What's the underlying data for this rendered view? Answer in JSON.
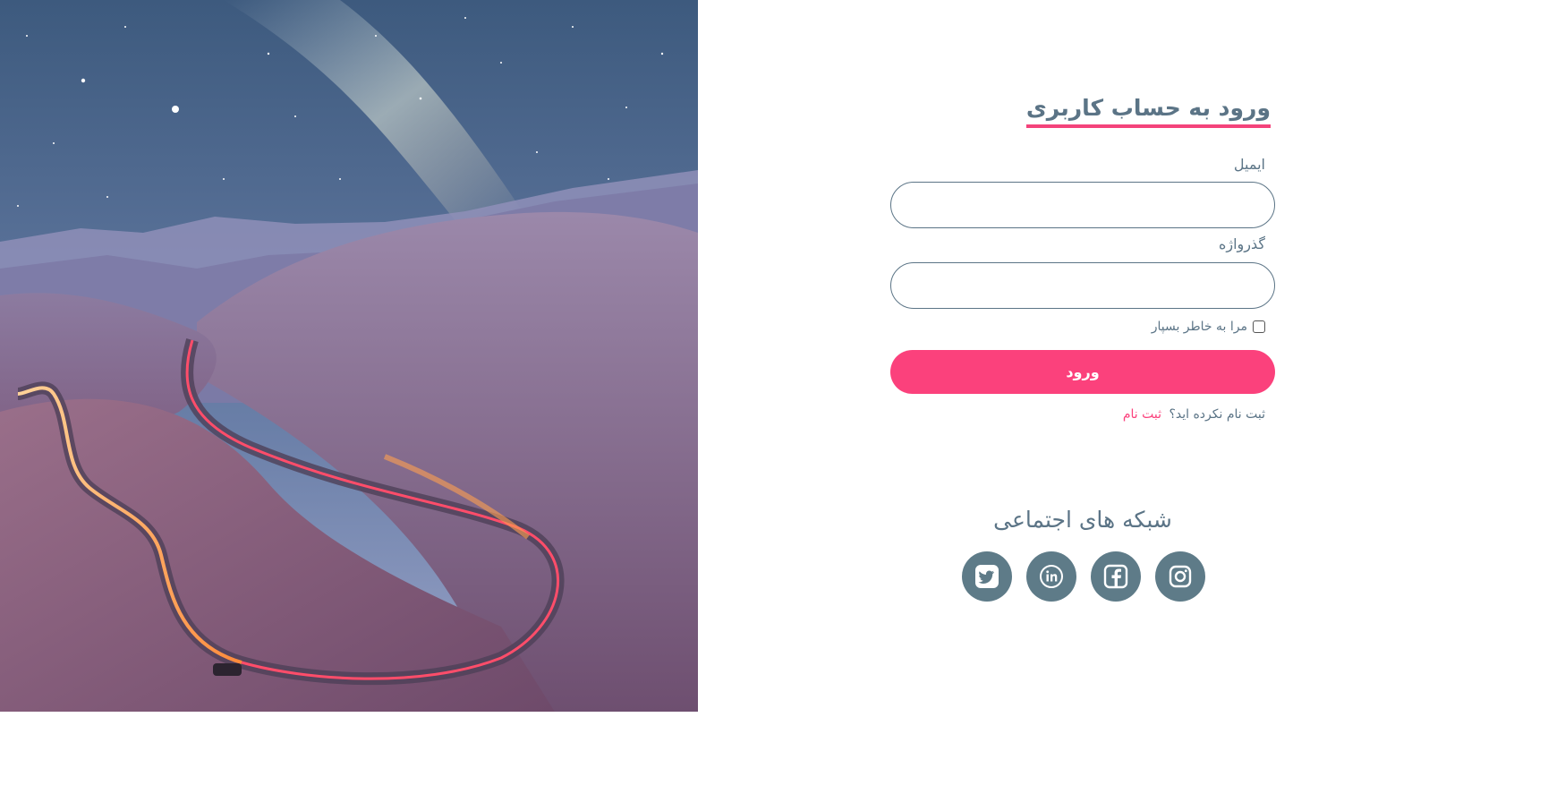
{
  "login": {
    "title": "ورود به حساب کاربری",
    "email_label": "ایمیل",
    "password_label": "گذرواژه",
    "email_value": "",
    "password_value": "",
    "remember_label": "مرا به خاطر بسپار",
    "remember_checked": false,
    "submit_label": "ورود",
    "register_prompt": "ثبت نام نکرده اید؟",
    "register_link": "ثبت نام"
  },
  "social": {
    "title": "شبکه های اجتماعی",
    "icons": [
      "twitter-icon",
      "linkedin-icon",
      "facebook-icon",
      "instagram-icon"
    ]
  },
  "colors": {
    "accent": "#fb417c",
    "text": "#5b7486",
    "social_bg": "#5e7b88"
  }
}
